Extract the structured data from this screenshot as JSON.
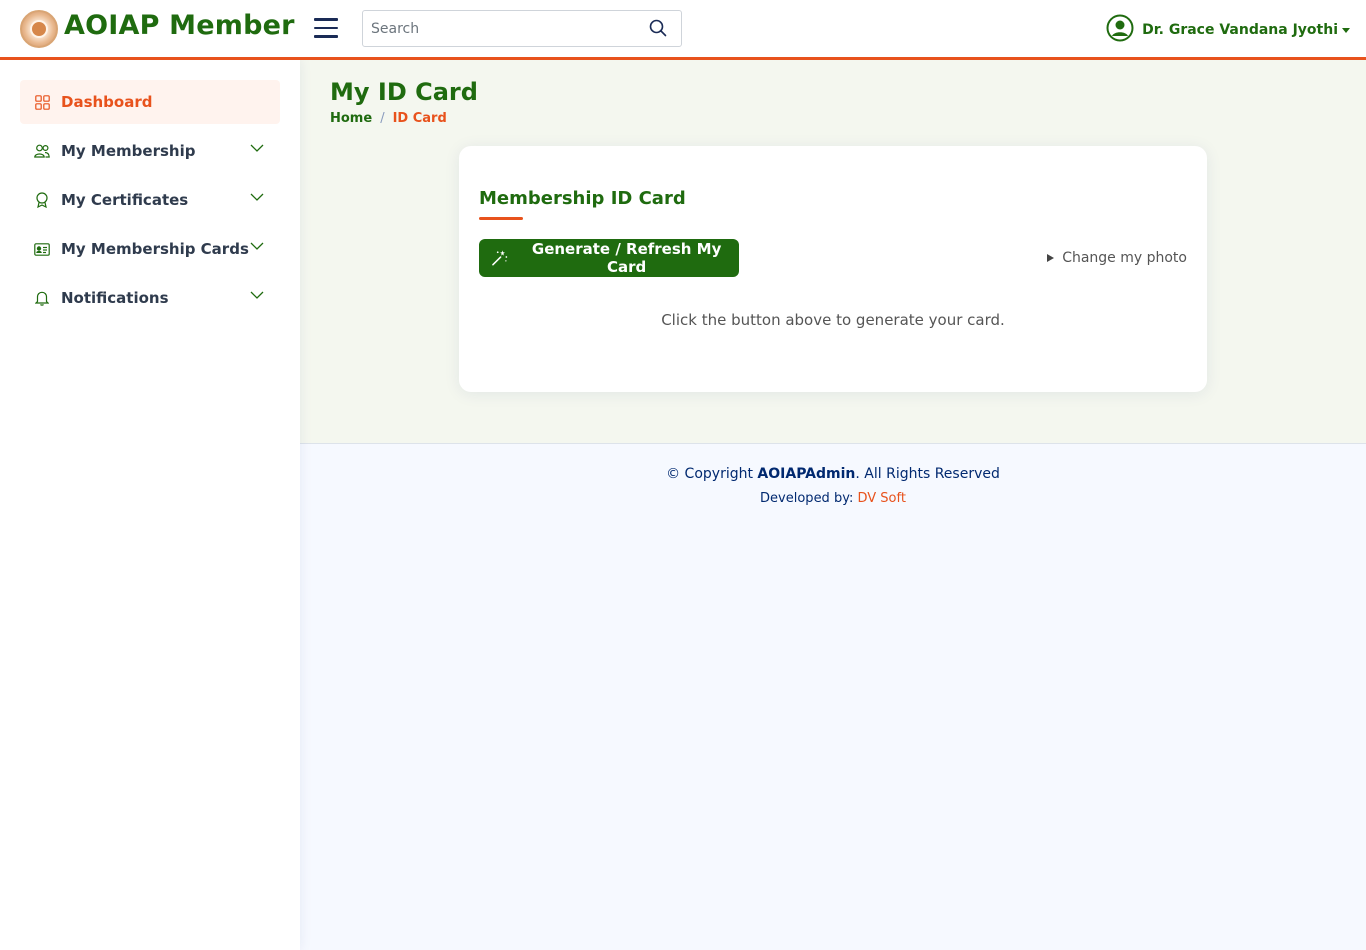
{
  "header": {
    "brand": "AOIAP Member",
    "search_placeholder": "Search",
    "user_name": "Dr. Grace Vandana Jyothi"
  },
  "sidebar": {
    "items": [
      {
        "label": "Dashboard",
        "icon": "grid-icon",
        "active": true
      },
      {
        "label": "My Membership",
        "icon": "people-icon"
      },
      {
        "label": "My Certificates",
        "icon": "award-icon"
      },
      {
        "label": "My Membership Cards",
        "icon": "id-card-icon"
      },
      {
        "label": "Notifications",
        "icon": "bell-icon"
      }
    ]
  },
  "page": {
    "title": "My ID Card",
    "breadcrumb": {
      "home": "Home",
      "separator": "/",
      "current": "ID Card"
    }
  },
  "card": {
    "title": "Membership ID Card",
    "generate_button": "Generate / Refresh My Card",
    "change_photo": "Change my photo",
    "hint": "Click the button above to generate your card."
  },
  "footer": {
    "copyright_prefix": "© Copyright ",
    "copyright_brand": "AOIAPAdmin",
    "copyright_suffix": ". All Rights Reserved",
    "developed_by": "Developed by: ",
    "developer": "DV Soft"
  },
  "colors": {
    "brand_green": "#1f6b0f",
    "accent_orange": "#e8521c"
  }
}
